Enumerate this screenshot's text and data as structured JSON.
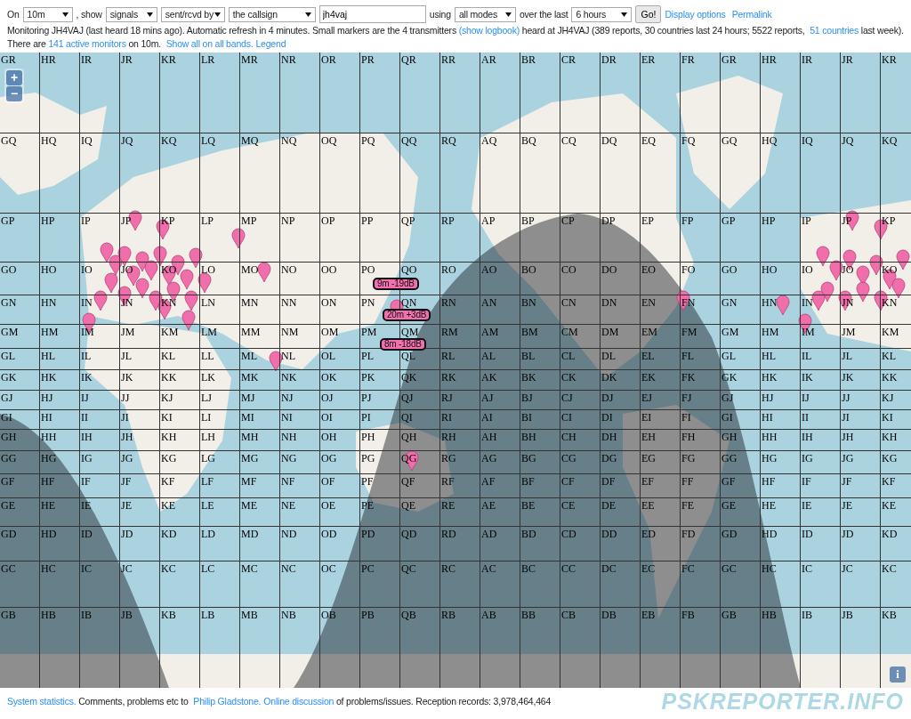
{
  "controls": {
    "on_label": "On",
    "band": "10m",
    "show_label": ", show",
    "show": "signals",
    "direction": "sent/rcvd by",
    "target": "the callsign",
    "callsign": "jh4vaj",
    "using_label": "using",
    "mode": "all modes",
    "over_label": "over the last",
    "period": "6 hours",
    "go_button": "Go!",
    "links": [
      "Display options",
      "Permalink"
    ]
  },
  "status_line": [
    {
      "kind": "text",
      "text": "Monitoring JH4VAJ (last heard 18 mins ago). Automatic refresh in 4 minutes. Small markers are the 4 transmitters "
    },
    {
      "kind": "link",
      "text": "(show logbook)"
    },
    {
      "kind": "text",
      "text": " heard at JH4VAJ (389 reports, 30 countries last 24 hours; 5522 reports, "
    },
    {
      "kind": "link",
      "text": "51 countries"
    },
    {
      "kind": "text",
      "text": " last week)."
    }
  ],
  "monitors_line": [
    {
      "kind": "text",
      "text": "There are "
    },
    {
      "kind": "link",
      "text": "141 active monitors"
    },
    {
      "kind": "text",
      "text": " on 10m. "
    },
    {
      "kind": "link",
      "text": "Show all on all bands."
    },
    {
      "kind": "link",
      "text": "Legend"
    }
  ],
  "map": {
    "zoom_in": "+",
    "zoom_out": "−",
    "info": "i",
    "grid": [
      [
        "GR",
        "HR",
        "IR",
        "JR",
        "KR",
        "LR",
        "MR",
        "NR",
        "OR",
        "PR",
        "QR",
        "RR",
        "AR",
        "BR",
        "CR",
        "DR",
        "ER",
        "FR",
        "GR",
        "HR",
        "IR",
        "JR",
        "KR"
      ],
      [
        "GQ",
        "HQ",
        "IQ",
        "JQ",
        "KQ",
        "LQ",
        "MQ",
        "NQ",
        "OQ",
        "PQ",
        "QQ",
        "RQ",
        "AQ",
        "BQ",
        "CQ",
        "DQ",
        "EQ",
        "FQ",
        "GQ",
        "HQ",
        "IQ",
        "JQ",
        "KQ"
      ],
      [
        "GP",
        "HP",
        "IP",
        "JP",
        "KP",
        "LP",
        "MP",
        "NP",
        "OP",
        "PP",
        "QP",
        "RP",
        "AP",
        "BP",
        "CP",
        "DP",
        "EP",
        "FP",
        "GP",
        "HP",
        "IP",
        "JP",
        "KP"
      ],
      [
        "GO",
        "HO",
        "IO",
        "JO",
        "KO",
        "LO",
        "MO",
        "NO",
        "OO",
        "PO",
        "QO",
        "RO",
        "AO",
        "BO",
        "CO",
        "DO",
        "EO",
        "FO",
        "GO",
        "HO",
        "IO",
        "JO",
        "KO"
      ],
      [
        "GN",
        "HN",
        "IN",
        "JN",
        "KN",
        "LN",
        "MN",
        "NN",
        "ON",
        "PN",
        "QN",
        "RN",
        "AN",
        "BN",
        "CN",
        "DN",
        "EN",
        "FN",
        "GN",
        "HN",
        "IN",
        "JN",
        "KN"
      ],
      [
        "GM",
        "HM",
        "IM",
        "JM",
        "KM",
        "LM",
        "MM",
        "NM",
        "OM",
        "PM",
        "QM",
        "RM",
        "AM",
        "BM",
        "CM",
        "DM",
        "EM",
        "FM",
        "GM",
        "HM",
        "IM",
        "JM",
        "KM"
      ],
      [
        "GL",
        "HL",
        "IL",
        "JL",
        "KL",
        "LL",
        "ML",
        "NL",
        "OL",
        "PL",
        "QL",
        "RL",
        "AL",
        "BL",
        "CL",
        "DL",
        "EL",
        "FL",
        "GL",
        "HL",
        "IL",
        "JL",
        "KL"
      ],
      [
        "GK",
        "HK",
        "IK",
        "JK",
        "KK",
        "LK",
        "MK",
        "NK",
        "OK",
        "PK",
        "QK",
        "RK",
        "AK",
        "BK",
        "CK",
        "DK",
        "EK",
        "FK",
        "GK",
        "HK",
        "IK",
        "JK",
        "KK"
      ],
      [
        "GJ",
        "HJ",
        "IJ",
        "JJ",
        "KJ",
        "LJ",
        "MJ",
        "NJ",
        "OJ",
        "PJ",
        "QJ",
        "RJ",
        "AJ",
        "BJ",
        "CJ",
        "DJ",
        "EJ",
        "FJ",
        "GJ",
        "HJ",
        "IJ",
        "JJ",
        "KJ"
      ],
      [
        "GI",
        "HI",
        "II",
        "JI",
        "KI",
        "LI",
        "MI",
        "NI",
        "OI",
        "PI",
        "QI",
        "RI",
        "AI",
        "BI",
        "CI",
        "DI",
        "EI",
        "FI",
        "GI",
        "HI",
        "II",
        "JI",
        "KI"
      ],
      [
        "GH",
        "HH",
        "IH",
        "JH",
        "KH",
        "LH",
        "MH",
        "NH",
        "OH",
        "PH",
        "QH",
        "RH",
        "AH",
        "BH",
        "CH",
        "DH",
        "EH",
        "FH",
        "GH",
        "HH",
        "IH",
        "JH",
        "KH"
      ],
      [
        "GG",
        "HG",
        "IG",
        "JG",
        "KG",
        "LG",
        "MG",
        "NG",
        "OG",
        "PG",
        "QG",
        "RG",
        "AG",
        "BG",
        "CG",
        "DG",
        "EG",
        "FG",
        "GG",
        "HG",
        "IG",
        "JG",
        "KG"
      ],
      [
        "GF",
        "HF",
        "IF",
        "JF",
        "KF",
        "LF",
        "MF",
        "NF",
        "OF",
        "PF",
        "QF",
        "RF",
        "AF",
        "BF",
        "CF",
        "DF",
        "EF",
        "FF",
        "GF",
        "HF",
        "IF",
        "JF",
        "KF"
      ],
      [
        "GE",
        "HE",
        "IE",
        "JE",
        "KE",
        "LE",
        "ME",
        "NE",
        "OE",
        "PE",
        "QE",
        "RE",
        "AE",
        "BE",
        "CE",
        "DE",
        "EE",
        "FE",
        "GE",
        "HE",
        "IE",
        "JE",
        "KE"
      ],
      [
        "GD",
        "HD",
        "ID",
        "JD",
        "KD",
        "LD",
        "MD",
        "ND",
        "OD",
        "PD",
        "QD",
        "RD",
        "AD",
        "BD",
        "CD",
        "DD",
        "ED",
        "FD",
        "GD",
        "HD",
        "ID",
        "JD",
        "KD"
      ],
      [
        "GC",
        "HC",
        "IC",
        "JC",
        "KC",
        "LC",
        "MC",
        "NC",
        "OC",
        "PC",
        "QC",
        "RC",
        "AC",
        "BC",
        "CC",
        "DC",
        "EC",
        "FC",
        "GC",
        "HC",
        "IC",
        "JC",
        "KC"
      ],
      [
        "GB",
        "HB",
        "IB",
        "JB",
        "KB",
        "LB",
        "MB",
        "NB",
        "OB",
        "PB",
        "QB",
        "RB",
        "AB",
        "BB",
        "CB",
        "DB",
        "EB",
        "FB",
        "GB",
        "HB",
        "IB",
        "JB",
        "KB"
      ]
    ],
    "callouts": [
      "9m -19dB",
      "20m +3dB",
      "8m -18dB"
    ]
  },
  "footer": {
    "segments": [
      {
        "kind": "link",
        "text": "System statistics."
      },
      {
        "kind": "text",
        "text": " Comments, problems etc to "
      },
      {
        "kind": "link",
        "text": "Philip Gladstone."
      },
      {
        "kind": "link",
        "text": "Online discussion"
      },
      {
        "kind": "text",
        "text": " of problems/issues. Reception records: 3,978,464,464"
      }
    ],
    "logo": "PSKREPORTER.INFO"
  }
}
